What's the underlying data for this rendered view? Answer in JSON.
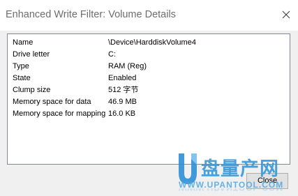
{
  "window": {
    "title": "Enhanced Write Filter: Volume Details"
  },
  "details": [
    {
      "key": "Name",
      "value": "\\Device\\HarddiskVolume4"
    },
    {
      "key": "Drive letter",
      "value": "C:"
    },
    {
      "key": "Type",
      "value": "RAM (Reg)"
    },
    {
      "key": "State",
      "value": "Enabled"
    },
    {
      "key": "Clump size",
      "value": "512 字节"
    },
    {
      "key": "Memory space for data",
      "value": "46.9 MB"
    },
    {
      "key": "Memory space for mapping",
      "value": "16.0 KB"
    }
  ],
  "footer": {
    "close_label": "Close"
  },
  "watermark": {
    "brand_cn": "盘量产网",
    "url": "WWW.UPANTOOL.COM"
  },
  "icons": {
    "title_close": "close-icon",
    "watermark_logo": "u-logo-icon"
  },
  "colors": {
    "title_text": "#6d6d6d",
    "watermark_blue": "#3a9ad9",
    "button_face": "#e1e1e1"
  }
}
